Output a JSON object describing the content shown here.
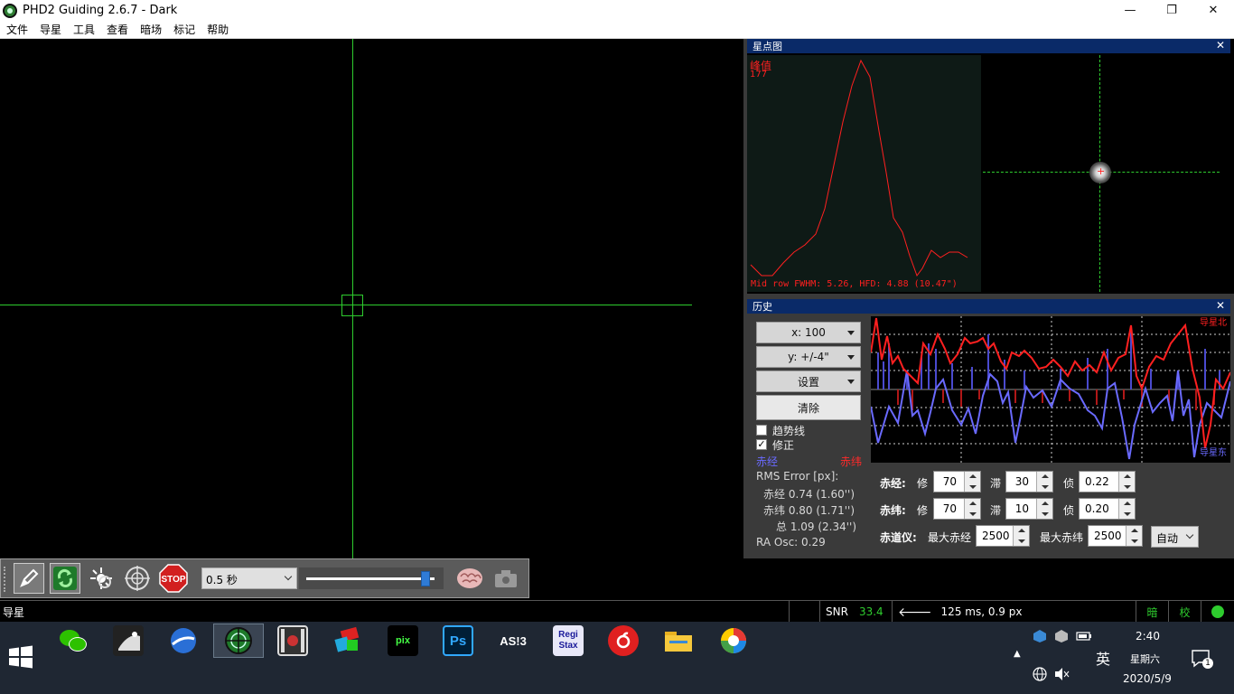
{
  "window": {
    "title": "PHD2 Guiding 2.6.7 - Dark",
    "controls": [
      "—",
      "❐",
      "✕"
    ]
  },
  "menu": [
    "文件",
    "导星",
    "工具",
    "查看",
    "暗场",
    "标记",
    "帮助"
  ],
  "star_profile": {
    "title": "星点图",
    "peak_label": "峰值",
    "peak_value": "177",
    "footer": "Mid row FWHM: 5.26, HFD: 4.88 (10.47\")"
  },
  "history": {
    "title": "历史",
    "x_scale": "x: 100",
    "y_scale": "y: +/-4\"",
    "settings": "设置",
    "clear": "清除",
    "trendline": "趋势线",
    "trendline_checked": false,
    "corrections": "修正",
    "corrections_checked": true,
    "legend_ra": "赤经",
    "legend_dec": "赤纬",
    "rms_title": "RMS Error [px]:",
    "rms_ra": "赤经 0.74 (1.60'')",
    "rms_dec": "赤纬 0.80 (1.71'')",
    "rms_total": "总 1.09 (2.34'')",
    "ra_osc": "RA Osc: 0.29",
    "graph_label_north": "导星北",
    "graph_label_east": "导星东",
    "colors": {
      "ra": "#6a6aff",
      "dec": "#ff2020"
    }
  },
  "params": {
    "ra_label": "赤经:",
    "dec_label": "赤纬:",
    "mount_label": "赤道仪:",
    "agg_label": "修",
    "hyst_label": "滞",
    "minmo_label": "侦",
    "ra_agg": "70",
    "ra_hyst": "30",
    "ra_minmo": "0.22",
    "dec_agg": "70",
    "dec_minmo_label_value": "10",
    "dec_minmo": "0.20",
    "max_ra_label": "最大赤经",
    "max_ra": "2500",
    "max_dec_label": "最大赤纬",
    "max_dec": "2500",
    "dec_mode": "自动"
  },
  "toolbar": {
    "exposure": "0.5 秒",
    "exposure_slider_level": 0.93
  },
  "statusbar": {
    "state": "导星",
    "snr_label": "SNR",
    "snr_value": "33.4",
    "pulse": "125 ms, 0.9 px",
    "dark": "暗",
    "cal": "校"
  },
  "taskbar": {
    "apps": [
      "wechat-icon",
      "stellarium-icon",
      "google-earth-icon",
      "phd2-icon",
      "video-icon",
      "mosaic-icon",
      "pixinsight-icon",
      "photoshop-icon",
      "asi-icon",
      "registax-icon",
      "netease-music-icon",
      "file-explorer-icon",
      "browser-icon"
    ],
    "ps_label": "Ps",
    "asi_label": "AS!3",
    "regi_label": "Regi",
    "stax_label": "Stax",
    "ime": "英",
    "time": "2:40",
    "weekday": "星期六",
    "date": "2020/5/9",
    "notif_count": "1"
  }
}
